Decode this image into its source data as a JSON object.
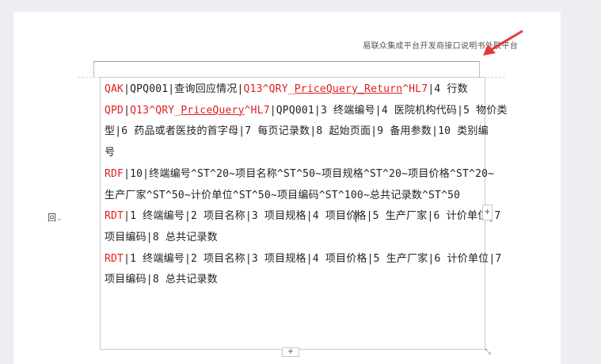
{
  "header": {
    "text": "易联众集成平台开发商接口说明书外联平台"
  },
  "table": {
    "lines": [
      {
        "segments": [
          {
            "t": "QAK",
            "c": "red"
          },
          {
            "t": "|QPQ001|查询回应情况|",
            "c": "black"
          },
          {
            "t": "Q13^QRY_",
            "c": "red"
          },
          {
            "t": "PriceQuery_Return",
            "c": "red-ul"
          },
          {
            "t": "^HL7",
            "c": "red"
          },
          {
            "t": "|4 行数",
            "c": "black"
          }
        ]
      },
      {
        "segments": [
          {
            "t": "QPD",
            "c": "red"
          },
          {
            "t": "|",
            "c": "black"
          },
          {
            "t": "Q13^QRY_",
            "c": "red"
          },
          {
            "t": "PriceQuery",
            "c": "red-ul"
          },
          {
            "t": "^HL7",
            "c": "red"
          },
          {
            "t": "|QPQ001|3 终端编号|4 医院机构代码|5 物价类",
            "c": "black"
          }
        ]
      },
      {
        "segments": [
          {
            "t": "型|6 药品或者医技的首字母|7 每页记录数|8 起始页面|9 备用参数|10 类别编",
            "c": "black"
          }
        ]
      },
      {
        "segments": [
          {
            "t": "号",
            "c": "black"
          }
        ]
      },
      {
        "segments": [
          {
            "t": "RDF",
            "c": "red"
          },
          {
            "t": "|10|终端编号^ST^20~项目名称^ST^50~项目规格^ST^20~项目价格^ST^20~",
            "c": "black"
          }
        ]
      },
      {
        "segments": [
          {
            "t": "生产厂家^ST^50~计价单位^ST^50~项目编码^ST^100~总共记录数^ST^50",
            "c": "black"
          }
        ]
      },
      {
        "segments": [
          {
            "t": "RDT",
            "c": "red"
          },
          {
            "t": "|1 终端编号|2 项目名称|3 项目规格|4 项目价",
            "c": "black"
          },
          {
            "t": "",
            "c": "cursor"
          },
          {
            "t": "格|5 生产厂家|6 计价单位|7",
            "c": "black"
          }
        ]
      },
      {
        "segments": [
          {
            "t": "项目编码|8 总共记录数",
            "c": "black"
          }
        ]
      },
      {
        "segments": [
          {
            "t": "RDT",
            "c": "red"
          },
          {
            "t": "|1 终端编号|2 项目名称|3 项目规格|4 项目价格|5 生产厂家|6 计价单位|7",
            "c": "black"
          }
        ]
      },
      {
        "segments": [
          {
            "t": "项目编码|8 总共记录数",
            "c": "black"
          }
        ]
      }
    ]
  },
  "handles": {
    "side": "+",
    "bottom": "+",
    "corner": "⤡"
  },
  "left_widget": {
    "label": "回",
    "chevron": "⌄"
  },
  "colors": {
    "accent_red": "#e02020",
    "arrow_red": "#e53935"
  }
}
